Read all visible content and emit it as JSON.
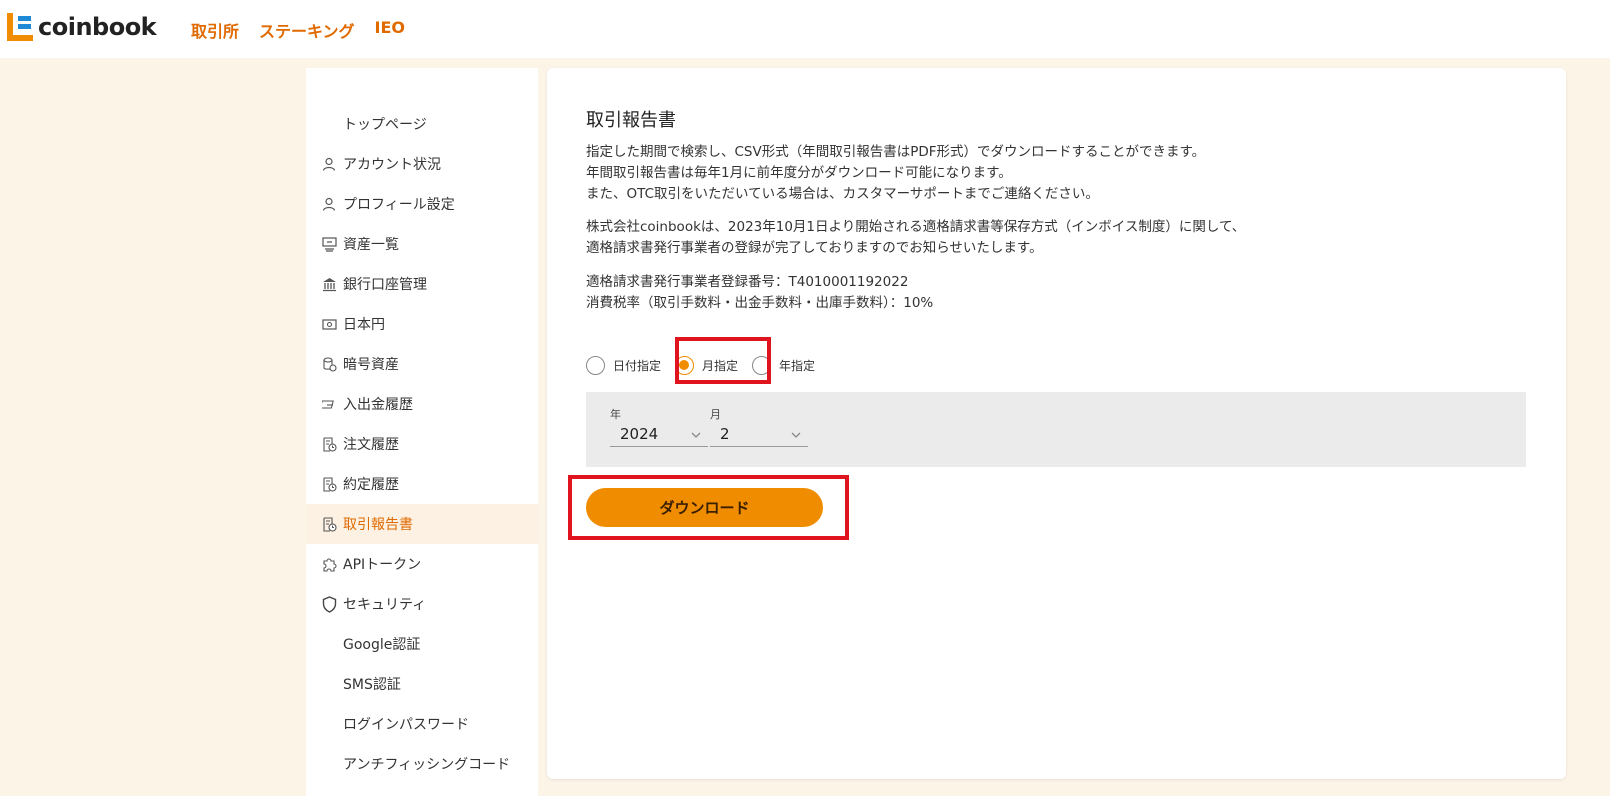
{
  "brand": {
    "name": "coinbook"
  },
  "nav": {
    "items": [
      "取引所",
      "ステーキング",
      "IEO"
    ]
  },
  "sidebar": {
    "items": [
      {
        "label": "トップページ",
        "icon": "none"
      },
      {
        "label": "アカウント状況",
        "icon": "person-icon"
      },
      {
        "label": "プロフィール設定",
        "icon": "person-icon"
      },
      {
        "label": "資産一覧",
        "icon": "asset-list-icon"
      },
      {
        "label": "銀行口座管理",
        "icon": "bank-icon"
      },
      {
        "label": "日本円",
        "icon": "banknote-icon"
      },
      {
        "label": "暗号資産",
        "icon": "coins-icon"
      },
      {
        "label": "入出金履歴",
        "icon": "transfer-icon"
      },
      {
        "label": "注文履歴",
        "icon": "receipt-clock-icon"
      },
      {
        "label": "約定履歴",
        "icon": "receipt-clock-icon"
      },
      {
        "label": "取引報告書",
        "icon": "receipt-clock-icon",
        "active": true
      },
      {
        "label": "APIトークン",
        "icon": "puzzle-icon"
      },
      {
        "label": "セキュリティ",
        "icon": "shield-icon"
      },
      {
        "label": "Google認証",
        "icon": "none"
      },
      {
        "label": "SMS認証",
        "icon": "none"
      },
      {
        "label": "ログインパスワード",
        "icon": "none"
      },
      {
        "label": "アンチフィッシングコード",
        "icon": "none"
      }
    ]
  },
  "main": {
    "title": "取引報告書",
    "desc1": [
      "指定した期間で検索し、CSV形式（年間取引報告書はPDF形式）でダウンロードすることができます。",
      "年間取引報告書は毎年1月に前年度分がダウンロード可能になります。",
      "また、OTC取引をいただいている場合は、カスタマーサポートまでご連絡ください。"
    ],
    "desc2": [
      "株式会社coinbookは、2023年10月1日より開始される適格請求書等保存方式（インボイス制度）に関して、",
      "適格請求書発行事業者の登録が完了しておりますのでお知らせいたします。"
    ],
    "desc3": [
      "適格請求書発行事業者登録番号：T4010001192022",
      "消費税率（取引手数料・出金手数料・出庫手数料）：10%"
    ],
    "radios": [
      {
        "label": "日付指定",
        "checked": false
      },
      {
        "label": "月指定",
        "checked": true
      },
      {
        "label": "年指定",
        "checked": false
      }
    ],
    "year_label": "年",
    "year_value": "2024",
    "month_label": "月",
    "month_value": "2",
    "download_label": "ダウンロード"
  },
  "colors": {
    "accent": "#f08c00",
    "nav_text": "#e06a00",
    "highlight": "#e0141e",
    "background": "#fdf4e8"
  }
}
